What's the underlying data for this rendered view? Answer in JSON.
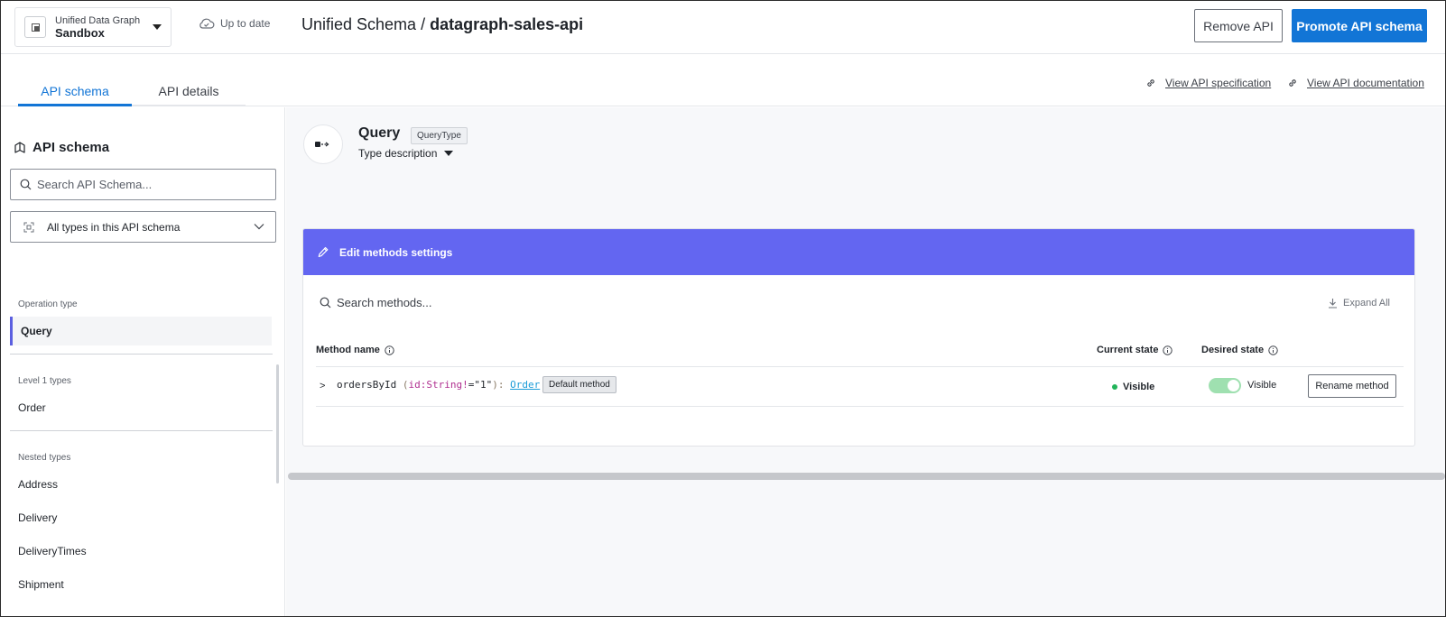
{
  "header": {
    "env_name": "Unified Data Graph",
    "env_value": "Sandbox",
    "sync_status": "Up to date",
    "title_prefix": "Unified Schema / ",
    "title_api": "datagraph-sales-api",
    "remove_label": "Remove API",
    "promote_label": "Promote API schema"
  },
  "tabs": [
    {
      "label": "API schema",
      "active": true
    },
    {
      "label": "API details",
      "active": false
    }
  ],
  "links": {
    "spec": "View API specification",
    "docs": "View API documentation"
  },
  "sidebar": {
    "title": "API schema",
    "search_placeholder": "Search API Schema...",
    "filter_value": "All types in this API schema",
    "sections": [
      {
        "title": "Operation type",
        "items": [
          "Query"
        ]
      },
      {
        "title": "Level 1 types",
        "items": [
          "Order"
        ]
      },
      {
        "title": "Nested types",
        "items": [
          "Address",
          "Delivery",
          "DeliveryTimes",
          "Shipment"
        ]
      }
    ]
  },
  "type_header": {
    "name": "Query",
    "badge": "QueryType",
    "description_toggle": "Type description"
  },
  "methods_card": {
    "header": "Edit methods settings",
    "search_placeholder": "Search methods...",
    "expand_label": "Expand All",
    "columns": {
      "method": "Method name",
      "current": "Current state",
      "desired": "Desired state"
    },
    "rows": [
      {
        "name": "ordersById",
        "open_paren": " (",
        "arg": "id:String!",
        "arg_value": "=\"1\"",
        "close": "): ",
        "return_type": "Order",
        "badge": "Default method",
        "current_state": "Visible",
        "desired_state": "Visible",
        "desired_on": true,
        "rename_label": "Rename method"
      }
    ]
  },
  "colors": {
    "accent_blue": "#1275d6",
    "card_header": "#6366f1",
    "visible_green": "#22b45a"
  }
}
